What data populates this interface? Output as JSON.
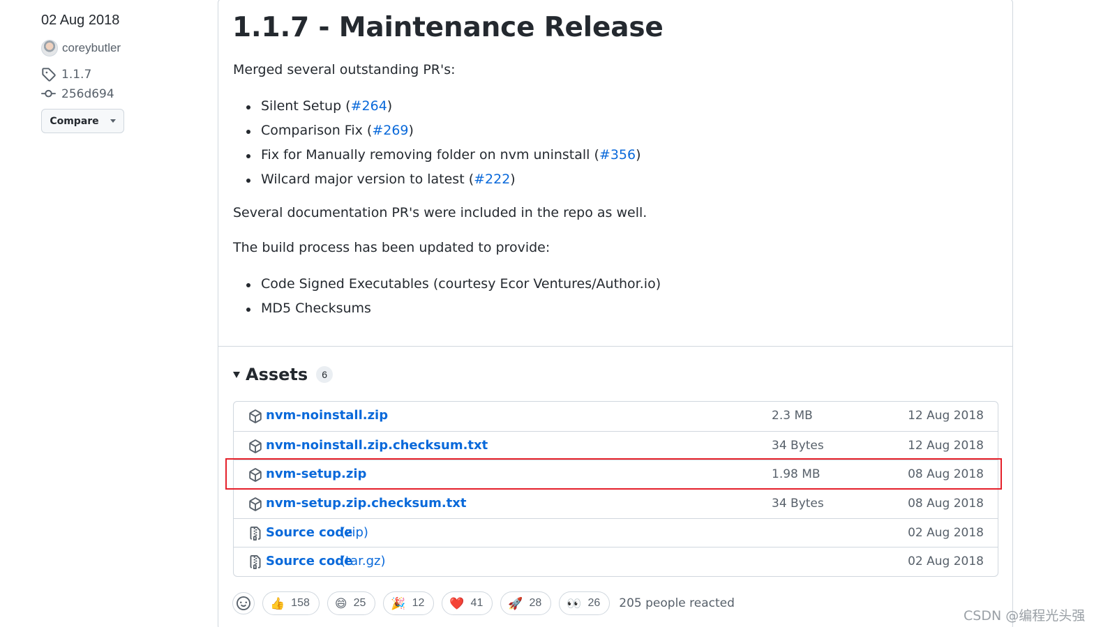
{
  "meta": {
    "date": "02 Aug 2018",
    "author": "coreybutler",
    "tag": "1.1.7",
    "commit": "256d694",
    "compare_label": "Compare"
  },
  "release": {
    "title": "1.1.7 - Maintenance Release",
    "intro": "Merged several outstanding PR's:",
    "prs": [
      {
        "text": "Silent Setup (",
        "ref": "#264",
        "tail": ")"
      },
      {
        "text": "Comparison Fix (",
        "ref": "#269",
        "tail": ")"
      },
      {
        "text": "Fix for Manually removing folder on nvm uninstall (",
        "ref": "#356",
        "tail": ")"
      },
      {
        "text": "Wilcard major version to latest (",
        "ref": "#222",
        "tail": ")"
      }
    ],
    "docs_note": "Several documentation PR's were included in the repo as well.",
    "build_note": "The build process has been updated to provide:",
    "build_items": [
      "Code Signed Executables (courtesy Ecor Ventures/Author.io)",
      "MD5 Checksums"
    ]
  },
  "assets": {
    "title": "Assets",
    "count": "6",
    "items": [
      {
        "name": "nvm-noinstall.zip",
        "sub": "",
        "size": "2.3 MB",
        "date": "12 Aug 2018",
        "icon": "package-icon"
      },
      {
        "name": "nvm-noinstall.zip.checksum.txt",
        "sub": "",
        "size": "34 Bytes",
        "date": "12 Aug 2018",
        "icon": "package-icon"
      },
      {
        "name": "nvm-setup.zip",
        "sub": "",
        "size": "1.98 MB",
        "date": "08 Aug 2018",
        "icon": "package-icon"
      },
      {
        "name": "nvm-setup.zip.checksum.txt",
        "sub": "",
        "size": "34 Bytes",
        "date": "08 Aug 2018",
        "icon": "package-icon"
      },
      {
        "name": "Source code",
        "sub": "(zip)",
        "size": "",
        "date": "02 Aug 2018",
        "icon": "file-zip-icon"
      },
      {
        "name": "Source code",
        "sub": "(tar.gz)",
        "size": "",
        "date": "02 Aug 2018",
        "icon": "file-zip-icon"
      }
    ]
  },
  "reactions": {
    "items": [
      {
        "emoji": "👍",
        "count": "158",
        "icon": "thumbs-up-icon"
      },
      {
        "emoji": "😄",
        "count": "25",
        "icon": "laugh-icon"
      },
      {
        "emoji": "🎉",
        "count": "12",
        "icon": "hooray-icon"
      },
      {
        "emoji": "❤️",
        "count": "41",
        "icon": "heart-icon"
      },
      {
        "emoji": "🚀",
        "count": "28",
        "icon": "rocket-icon"
      },
      {
        "emoji": "👀",
        "count": "26",
        "icon": "eyes-icon"
      }
    ],
    "summary": "205 people reacted"
  },
  "watermark": "CSDN @编程光头强",
  "colors": {
    "link": "#0969da",
    "text": "#24292f",
    "muted": "#57606a",
    "border": "#d0d7de",
    "highlight": "#e5202a"
  }
}
